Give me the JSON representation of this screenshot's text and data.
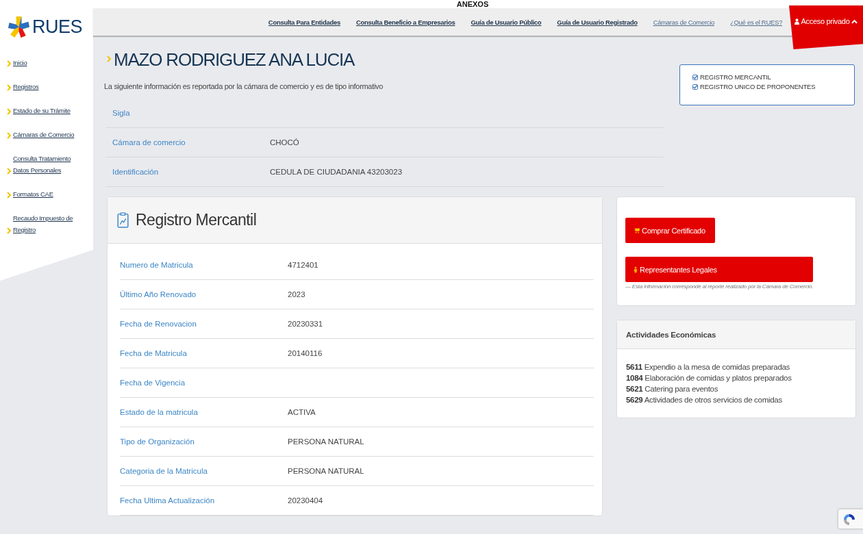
{
  "page_heading": "ANEXOS",
  "logo": {
    "text": "RUES"
  },
  "sidebar": {
    "items": [
      {
        "label": "Inicio"
      },
      {
        "label": "Registros"
      },
      {
        "label": "Estado de su Trámite"
      },
      {
        "label": "Cámaras de Comercio"
      },
      {
        "label": "Consulta Tratamiento Datos Personales"
      },
      {
        "label": "Formatos CAE"
      },
      {
        "label": "Recaudo Impuesto de Registro"
      }
    ]
  },
  "top_nav": {
    "links": [
      {
        "label": "Consulta Para Entidades",
        "emphasized": true
      },
      {
        "label": "Consulta Beneficio a Empresarios",
        "emphasized": true
      },
      {
        "label": "Guía de Usuario Público",
        "emphasized": true
      },
      {
        "label": "Guía de Usuario Registrado",
        "emphasized": true
      },
      {
        "label": "Cámaras de Comercio",
        "emphasized": false
      },
      {
        "label": "¿Qué es el RUES?",
        "emphasized": false
      }
    ],
    "access": {
      "label": "Acceso privado",
      "expanded": true,
      "options": [
        {
          "label": "REGISTRO MERCANTIL",
          "checked": true
        },
        {
          "label": "REGISTRO UNICO DE PROPONENTES",
          "checked": true
        }
      ]
    }
  },
  "person": {
    "name": "MAZO RODRIGUEZ ANA LUCIA",
    "intro": "La siguiente información es reportada por la cámara de comercio y es de tipo informativo",
    "fields": [
      {
        "label": "Sigla"
      },
      {
        "label": "Cámara de comercio",
        "value": "CHOCÓ"
      },
      {
        "label": "Identificación",
        "value": "CEDULA DE CIUDADANIA 43203023"
      }
    ]
  },
  "registro_mercantil": {
    "title": "Registro Mercantil",
    "rows": [
      {
        "label": "Numero de Matricula",
        "value": "4712401"
      },
      {
        "label": "Último Año Renovado",
        "value": "2023"
      },
      {
        "label": "Fecha de Renovacion",
        "value": "20230331"
      },
      {
        "label": "Fecha de Matricula",
        "value": "20140116"
      },
      {
        "label": "Fecha de Vigencia"
      },
      {
        "label": "Estado de la matricula",
        "value": "ACTIVA"
      },
      {
        "label": "Tipo de Organización",
        "value": "PERSONA NATURAL"
      },
      {
        "label": "Categoria de la Matricula",
        "value": "PERSONA NATURAL"
      },
      {
        "label": "Fecha Ultima Actualización",
        "value": "20230404"
      }
    ]
  },
  "actions": {
    "buttons": [
      {
        "label": "Comprar Certificado",
        "kind": "cart"
      },
      {
        "label": "Representantes Legales",
        "kind": "person"
      }
    ],
    "note": "— Esta información corresponde al reporte realizado por la Cámara de Comercio."
  },
  "activities": {
    "title": "Actividades Económicas",
    "items": [
      {
        "code": "5611",
        "description": "Expendio a la mesa de comidas preparadas"
      },
      {
        "code": "1084",
        "description": "Elaboración de comidas y platos preparados"
      },
      {
        "code": "5621",
        "description": "Catering para eventos"
      },
      {
        "code": "5629",
        "description": "Actividades de otros servicios de comidas"
      }
    ]
  }
}
